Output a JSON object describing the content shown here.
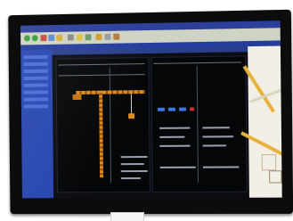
{
  "photo": {
    "colors": {
      "bezel": "#0c0c0e",
      "screen_chrome": "#2b3f9b",
      "toolbar": "#cfd3c4",
      "crane": "#e08a1a",
      "map_bg": "#f1efe6",
      "map_road": "#e7b23c"
    }
  }
}
